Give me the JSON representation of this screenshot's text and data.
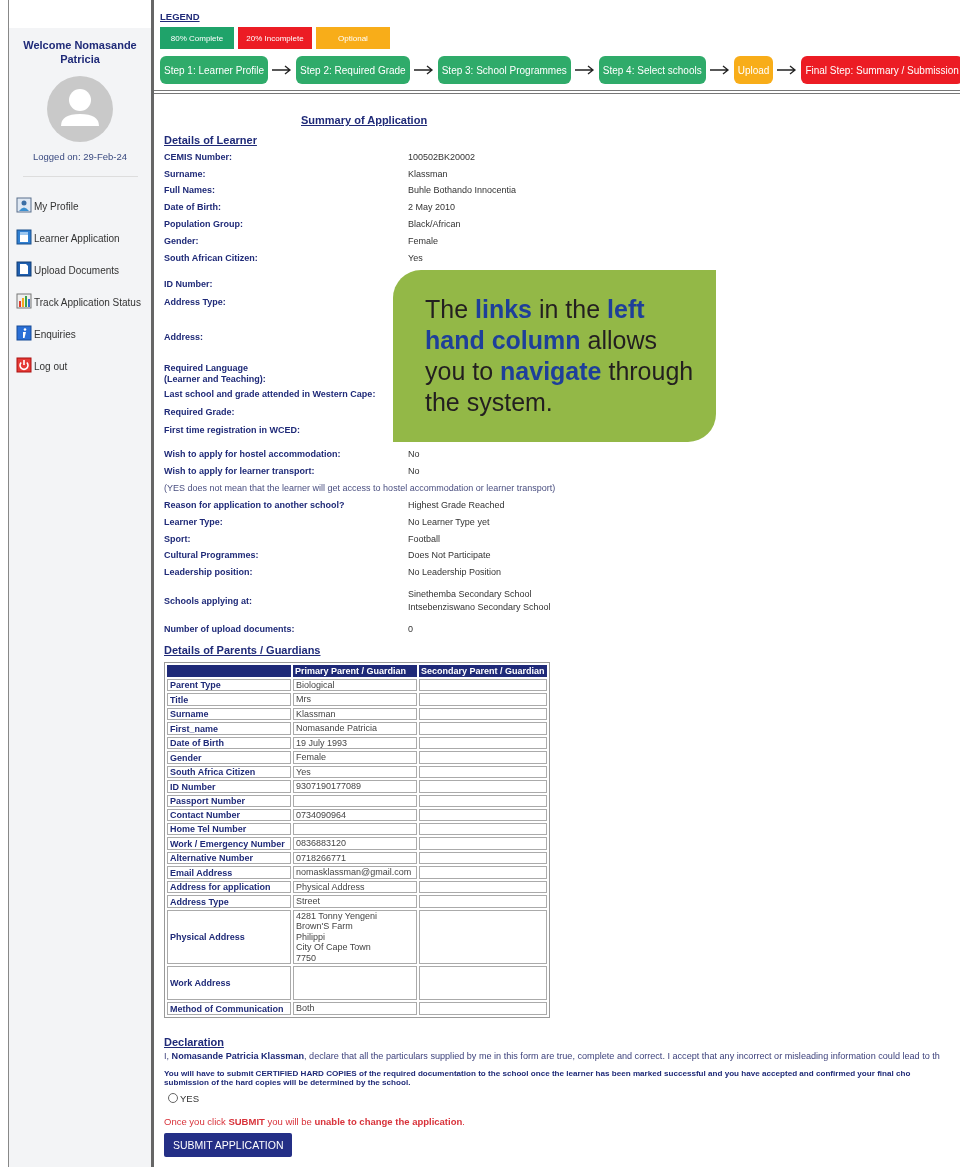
{
  "sidebar": {
    "welcome": "Welcome Nomasande Patricia",
    "logged_on": "Logged on: 29-Feb-24",
    "items": [
      {
        "label": "My Profile",
        "kind": "profile"
      },
      {
        "label": "Learner Application",
        "kind": "application"
      },
      {
        "label": "Upload Documents",
        "kind": "upload"
      },
      {
        "label": "Track Application Status",
        "kind": "chart"
      },
      {
        "label": "Enquiries",
        "kind": "info"
      },
      {
        "label": "Log out",
        "kind": "power"
      }
    ]
  },
  "legend": {
    "title": "LEGEND",
    "items": [
      {
        "label": "80% Complete",
        "color": "#1fa36a"
      },
      {
        "label": "20% Incomplete",
        "color": "#ec1c24"
      },
      {
        "label": "Optional",
        "color": "#f8ad19"
      }
    ]
  },
  "steps": [
    {
      "label": "Step 1: Learner Profile",
      "color": "#2fab6a"
    },
    {
      "label": "Step 2: Required Grade",
      "color": "#2fab6a"
    },
    {
      "label": "Step 3: School Programmes",
      "color": "#2fab6a"
    },
    {
      "label": "Step 4: Select schools",
      "color": "#2fab6a"
    },
    {
      "label": "Upload",
      "color": "#f8ad19"
    },
    {
      "label": "Final Step: Summary / Submission",
      "color": "#ec1c24"
    }
  ],
  "summary_title": "Summary of Application",
  "learner": {
    "title": "Details of Learner",
    "rows": [
      {
        "kind": "field",
        "label": "CEMIS Number:",
        "values": [
          "100502BK20002"
        ]
      },
      {
        "kind": "field",
        "label": "Surname:",
        "values": [
          "Klassman"
        ]
      },
      {
        "kind": "field",
        "label": "Full Names:",
        "values": [
          "Buhle Bothando Innocentia"
        ]
      },
      {
        "kind": "field",
        "label": "Date of Birth:",
        "values": [
          "2 May 2010"
        ]
      },
      {
        "kind": "field",
        "label": "Population Group:",
        "values": [
          "Black/African"
        ]
      },
      {
        "kind": "field",
        "label": "Gender:",
        "values": [
          "Female"
        ]
      },
      {
        "kind": "field",
        "label": "South African Citizen:",
        "values": [
          "Yes"
        ]
      }
    ],
    "covered_rows": [
      "ID Number:",
      "Address Type:",
      "Address:",
      "Required Language\n(Learner and Teaching):",
      "Last school and grade attended in Western Cape:",
      "Required Grade:",
      "First time registration in WCED:"
    ],
    "more_rows": [
      {
        "kind": "field",
        "label": "Wish to apply for hostel accommodation:",
        "values": [
          "No"
        ]
      },
      {
        "kind": "field",
        "label": "Wish to apply for learner transport:",
        "values": [
          "No"
        ]
      },
      {
        "kind": "note",
        "label": "(YES does not mean that the learner will get access to hostel accommodation or learner transport)"
      },
      {
        "kind": "field",
        "label": "Reason for application to another school?",
        "values": [
          "Highest Grade Reached"
        ]
      },
      {
        "kind": "field",
        "label": "Learner Type:",
        "values": [
          "No Learner Type yet"
        ]
      },
      {
        "kind": "field",
        "label": "Sport:",
        "values": [
          "Football"
        ]
      },
      {
        "kind": "field",
        "label": "Cultural Programmes:",
        "values": [
          "Does Not Participate"
        ]
      },
      {
        "kind": "field",
        "label": "Leadership position:",
        "values": [
          "No Leadership Position"
        ]
      },
      {
        "kind": "field",
        "label": "Schools applying at:",
        "values": [
          "Sinethemba Secondary School",
          "Intsebenziswano Secondary School"
        ]
      },
      {
        "kind": "field",
        "label": "Number of upload documents:",
        "values": [
          "0"
        ]
      }
    ]
  },
  "callout": {
    "text": "The **links** in the **left hand column** allows you to **navigate** through the system."
  },
  "parents": {
    "title": "Details of Parents / Guardians",
    "columns": [
      "Primary Parent / Guardian",
      "Secondary Parent / Guardian"
    ],
    "rows": [
      {
        "label": "Parent Type",
        "primary": [
          "Biological"
        ],
        "tall": false
      },
      {
        "label": "Title",
        "primary": [
          "Mrs"
        ],
        "tall": false
      },
      {
        "label": "Surname",
        "primary": [
          "Klassman"
        ],
        "tall": false
      },
      {
        "label": "First_name",
        "primary": [
          "Nomasande Patricia"
        ],
        "tall": false
      },
      {
        "label": "Date of Birth",
        "primary": [
          "19 July 1993"
        ],
        "tall": false
      },
      {
        "label": "Gender",
        "primary": [
          "Female"
        ],
        "tall": false
      },
      {
        "label": "South Africa Citizen",
        "primary": [
          "Yes"
        ],
        "tall": false
      },
      {
        "label": "ID Number",
        "primary": [
          "9307190177089"
        ],
        "tall": false
      },
      {
        "label": "Passport Number",
        "primary": [],
        "tall": false
      },
      {
        "label": "Contact Number",
        "primary": [
          "0734090964"
        ],
        "tall": false
      },
      {
        "label": "Home Tel Number",
        "primary": [],
        "tall": false
      },
      {
        "label": "Work / Emergency Number",
        "primary": [
          "0836883120"
        ],
        "tall": false
      },
      {
        "label": "Alternative Number",
        "primary": [
          "0718266771"
        ],
        "tall": false
      },
      {
        "label": "Email Address",
        "primary": [
          "nomasklassman@gmail.com"
        ],
        "tall": false
      },
      {
        "label": "Address for application",
        "primary": [
          "Physical Address"
        ],
        "tall": false
      },
      {
        "label": "Address Type",
        "primary": [
          "Street"
        ],
        "tall": false
      },
      {
        "label": "Physical Address",
        "primary": [
          "4281 Tonny Yengeni",
          "Brown'S Farm",
          "Philippi",
          "City Of Cape Town",
          "7750"
        ],
        "tall": false
      },
      {
        "label": "Work Address",
        "primary": [],
        "tall": true
      },
      {
        "label": "Method of Communication",
        "primary": [
          "Both"
        ],
        "tall": false
      }
    ]
  },
  "declaration": {
    "title": "Declaration",
    "statement": "I, **Nomasande Patricia Klassman**, declare that all the particulars supplied by me in this form are true, complete and correct. I accept that any incorrect or misleading information could lead to th",
    "notice_lines": [
      "You will have to submit CERTIFIED HARD COPIES of the required documentation to the school once the learner has been marked successful and you have accepted and confirmed your final cho",
      "submission of the hard copies will be determined by the school."
    ],
    "radio": {
      "label": "YES",
      "checked": false
    },
    "warning": "Once you click **SUBMIT** you will be **unable to change the application**.",
    "submit": "SUBMIT APPLICATION"
  }
}
